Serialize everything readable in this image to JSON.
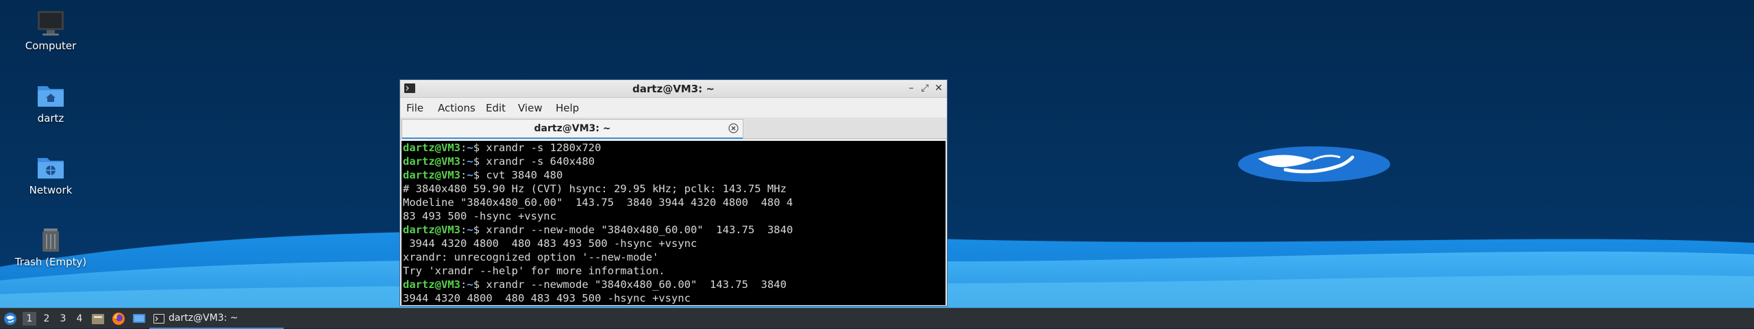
{
  "desktop": {
    "icons": [
      {
        "label": "Computer",
        "icon": "computer-icon"
      },
      {
        "label": "dartz",
        "icon": "home-folder-icon"
      },
      {
        "label": "Network",
        "icon": "network-folder-icon"
      },
      {
        "label": "Trash (Empty)",
        "icon": "trash-icon"
      }
    ]
  },
  "window": {
    "title": "dartz@VM3: ~",
    "controls": {
      "minimize": "–",
      "maximize": "⤢",
      "close": "✕"
    },
    "menu": [
      "File",
      "Actions",
      "Edit",
      "View",
      "Help"
    ],
    "tab": {
      "label": "dartz@VM3: ~"
    }
  },
  "terminal": {
    "prompt": {
      "user_host": "dartz@VM3",
      "sep": ":",
      "path": "~",
      "symbol": "$ "
    },
    "lines": [
      {
        "type": "cmd",
        "text": "xrandr -s 1280x720"
      },
      {
        "type": "cmd",
        "text": "xrandr -s 640x480"
      },
      {
        "type": "cmd",
        "text": "cvt 3840 480"
      },
      {
        "type": "out",
        "text": "# 3840x480 59.90 Hz (CVT) hsync: 29.95 kHz; pclk: 143.75 MHz"
      },
      {
        "type": "out",
        "text": "Modeline \"3840x480_60.00\"  143.75  3840 3944 4320 4800  480 4"
      },
      {
        "type": "out",
        "text": "83 493 500 -hsync +vsync"
      },
      {
        "type": "cmd",
        "text": "xrandr --new-mode \"3840x480_60.00\"  143.75  3840"
      },
      {
        "type": "out",
        "text": " 3944 4320 4800  480 483 493 500 -hsync +vsync"
      },
      {
        "type": "out",
        "text": "xrandr: unrecognized option '--new-mode'"
      },
      {
        "type": "out",
        "text": "Try 'xrandr --help' for more information."
      },
      {
        "type": "cmd",
        "text": "xrandr --newmode \"3840x480_60.00\"  143.75  3840"
      },
      {
        "type": "out",
        "text": "3944 4320 4800  480 483 493 500 -hsync +vsync"
      }
    ]
  },
  "taskbar": {
    "workspaces": [
      "1",
      "2",
      "3",
      "4"
    ],
    "active_workspace": "1",
    "task": {
      "label": "dartz@VM3: ~"
    }
  }
}
